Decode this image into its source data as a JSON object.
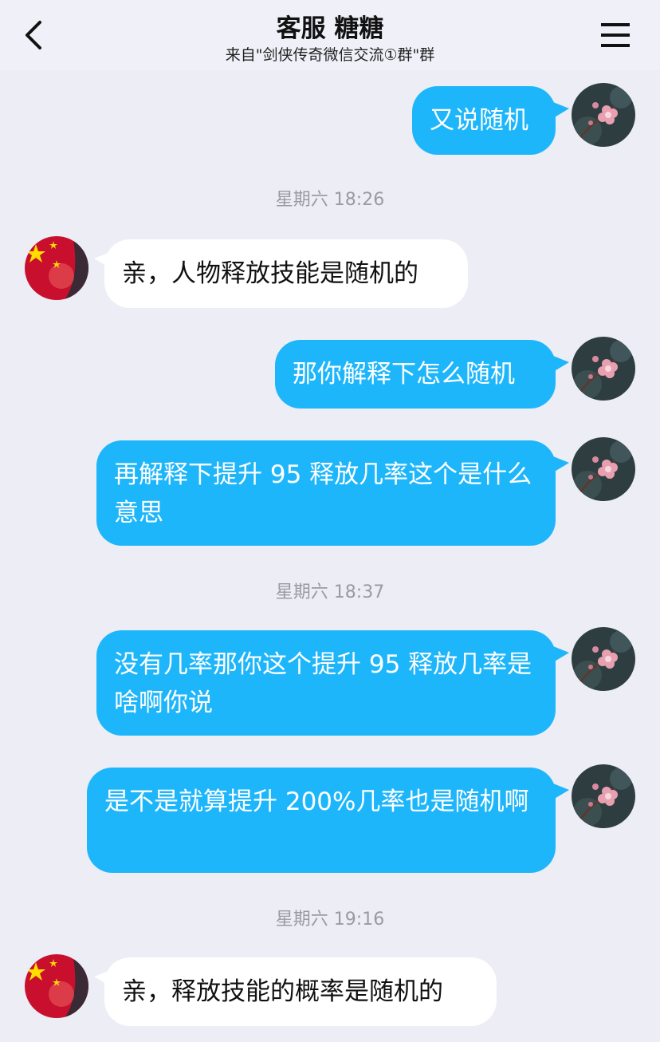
{
  "header": {
    "title": "客服 糖糖",
    "subtitle": "来自\"剑侠传奇微信交流①群\"群"
  },
  "icons": {
    "back": "chevron-left-icon",
    "menu": "hamburger-menu-icon"
  },
  "colors": {
    "background": "#ecedf5",
    "outgoing_bubble": "#1eb6fb",
    "incoming_bubble": "#ffffff",
    "timestamp": "#9a9aa2"
  },
  "timestamps": [
    "星期六 18:26",
    "星期六 18:37",
    "星期六 19:16"
  ],
  "messages": [
    {
      "sender": "me",
      "text": "又说随机"
    },
    {
      "sender": "them",
      "text": "亲，人物释放技能是随机的"
    },
    {
      "sender": "me",
      "text": "那你解释下怎么随机"
    },
    {
      "sender": "me",
      "text": "再解释下提升 95 释放几率这个是什么意思"
    },
    {
      "sender": "me",
      "text": "没有几率那你这个提升 95 释放几率是啥啊你说"
    },
    {
      "sender": "me",
      "text": "是不是就算提升 200%几率也是随机啊"
    },
    {
      "sender": "them",
      "text": "亲，释放技能的概率是随机的"
    }
  ]
}
